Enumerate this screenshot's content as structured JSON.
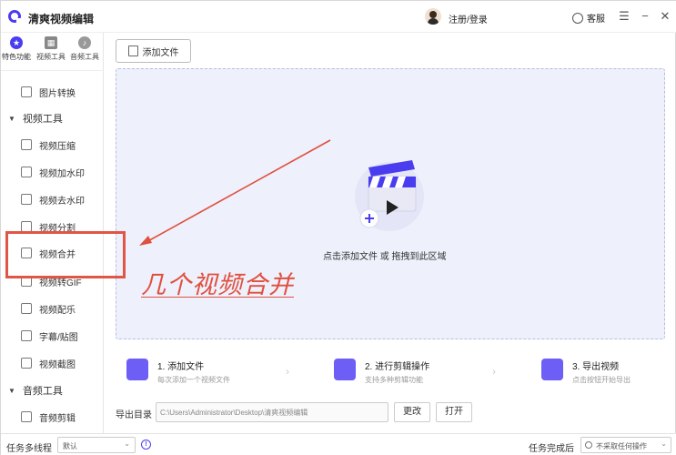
{
  "app": {
    "title": "清爽视频编辑",
    "login": "注册/登录",
    "service": "客服"
  },
  "categories": [
    {
      "label": "特色功能",
      "icon": "star-icon",
      "active": true
    },
    {
      "label": "视频工具",
      "icon": "film-icon",
      "active": false
    },
    {
      "label": "音频工具",
      "icon": "audio-icon",
      "active": false
    }
  ],
  "sidebar": {
    "top_item": "图片转换",
    "video_group": "视频工具",
    "video_items": [
      "视频压缩",
      "视频加水印",
      "视频去水印",
      "视频分割",
      "视频合并",
      "视频转GIF",
      "视频配乐",
      "字幕/贴图",
      "视频截图"
    ],
    "audio_group": "音频工具",
    "audio_items": [
      "音频剪辑"
    ]
  },
  "main": {
    "add_file": "添加文件",
    "drop_text": "点击添加文件 或 拖拽到此区域"
  },
  "steps": [
    {
      "title": "1. 添加文件",
      "desc": "每次添加一个视频文件"
    },
    {
      "title": "2. 进行剪辑操作",
      "desc": "支持多种剪辑功能"
    },
    {
      "title": "3. 导出视频",
      "desc": "点击按钮开始导出"
    }
  ],
  "export": {
    "label": "导出目录",
    "path": "C:\\Users\\Administrator\\Desktop\\清爽视频编辑",
    "change": "更改",
    "open": "打开"
  },
  "statusbar": {
    "multithread_label": "任务多线程",
    "multithread_value": "默认",
    "after_label": "任务完成后",
    "after_value": "不采取任何操作"
  },
  "annotation": {
    "text": "几个视频合并",
    "color": "#e0503f"
  },
  "colors": {
    "accent": "#4a3df0",
    "dropzone": "#eef0fb",
    "annotation": "#e0503f"
  }
}
